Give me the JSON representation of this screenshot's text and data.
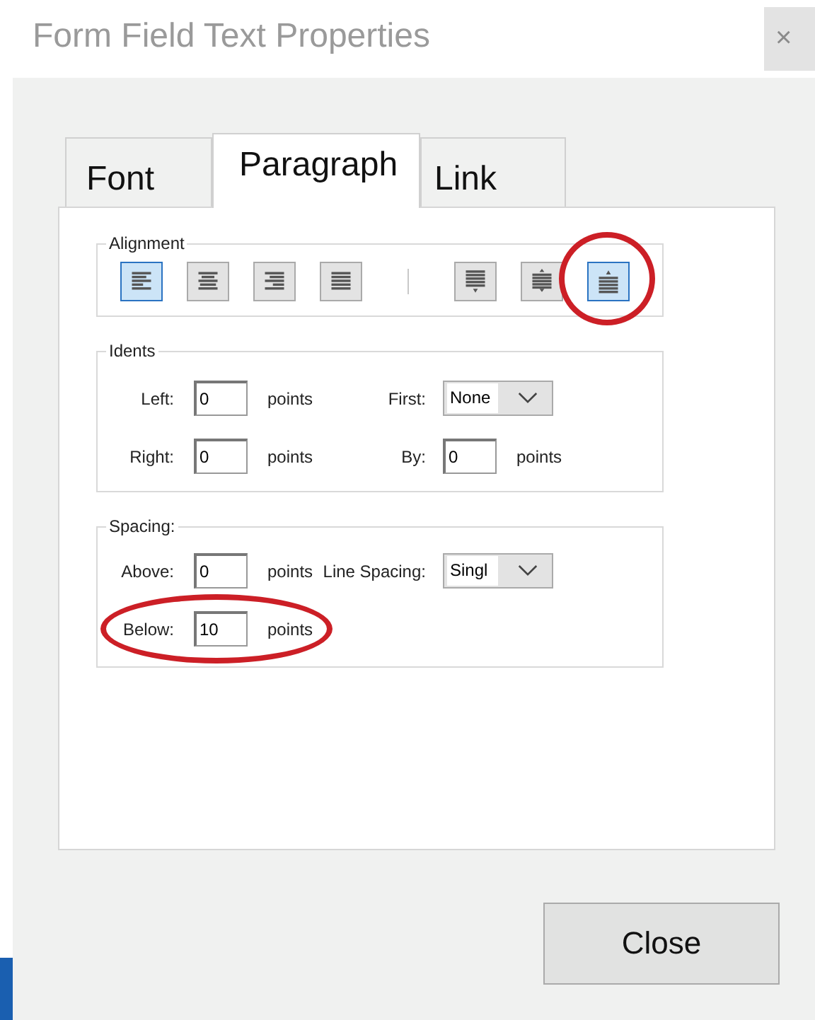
{
  "window": {
    "title": "Form Field Text Properties",
    "close": "×"
  },
  "tabs": [
    {
      "label": "Font",
      "selected": false
    },
    {
      "label": "Paragraph",
      "selected": true
    },
    {
      "label": "Link",
      "selected": false
    }
  ],
  "alignment": {
    "legend": "Alignment",
    "buttons": [
      {
        "kind": "left",
        "selected": true,
        "circled": false
      },
      {
        "kind": "center",
        "selected": false,
        "circled": false
      },
      {
        "kind": "right",
        "selected": false,
        "circled": false
      },
      {
        "kind": "justify",
        "selected": false,
        "circled": false
      },
      {
        "kind": "separator"
      },
      {
        "kind": "top",
        "selected": false,
        "circled": false
      },
      {
        "kind": "middle",
        "selected": false,
        "circled": false
      },
      {
        "kind": "bottom",
        "selected": true,
        "circled": true
      }
    ]
  },
  "idents": {
    "legend": "Idents",
    "rows": [
      {
        "circled": false,
        "cells": [
          {
            "kind": "label",
            "text": "Left:"
          },
          {
            "kind": "input",
            "value": "0"
          },
          {
            "kind": "unit",
            "text": "points"
          },
          {
            "kind": "label",
            "text": "First:"
          },
          {
            "kind": "dropdown",
            "value": "None"
          }
        ]
      },
      {
        "circled": false,
        "cells": [
          {
            "kind": "label",
            "text": "Right:"
          },
          {
            "kind": "input",
            "value": "0"
          },
          {
            "kind": "unit",
            "text": "points"
          },
          {
            "kind": "label",
            "text": "By:"
          },
          {
            "kind": "input",
            "value": "0"
          },
          {
            "kind": "unit",
            "text": "points"
          }
        ]
      }
    ]
  },
  "spacing": {
    "legend": "Spacing:",
    "rows": [
      {
        "circled": false,
        "cells": [
          {
            "kind": "label",
            "text": "Above:"
          },
          {
            "kind": "input",
            "value": "0"
          },
          {
            "kind": "unit",
            "text": "points"
          },
          {
            "kind": "label",
            "text": "Line Spacing:"
          },
          {
            "kind": "dropdown",
            "value": "Singl"
          }
        ]
      },
      {
        "circled": true,
        "cells": [
          {
            "kind": "label",
            "text": "Below:"
          },
          {
            "kind": "input",
            "value": "10"
          },
          {
            "kind": "unit",
            "text": "points"
          }
        ]
      }
    ]
  },
  "buttons": [
    "Close"
  ]
}
